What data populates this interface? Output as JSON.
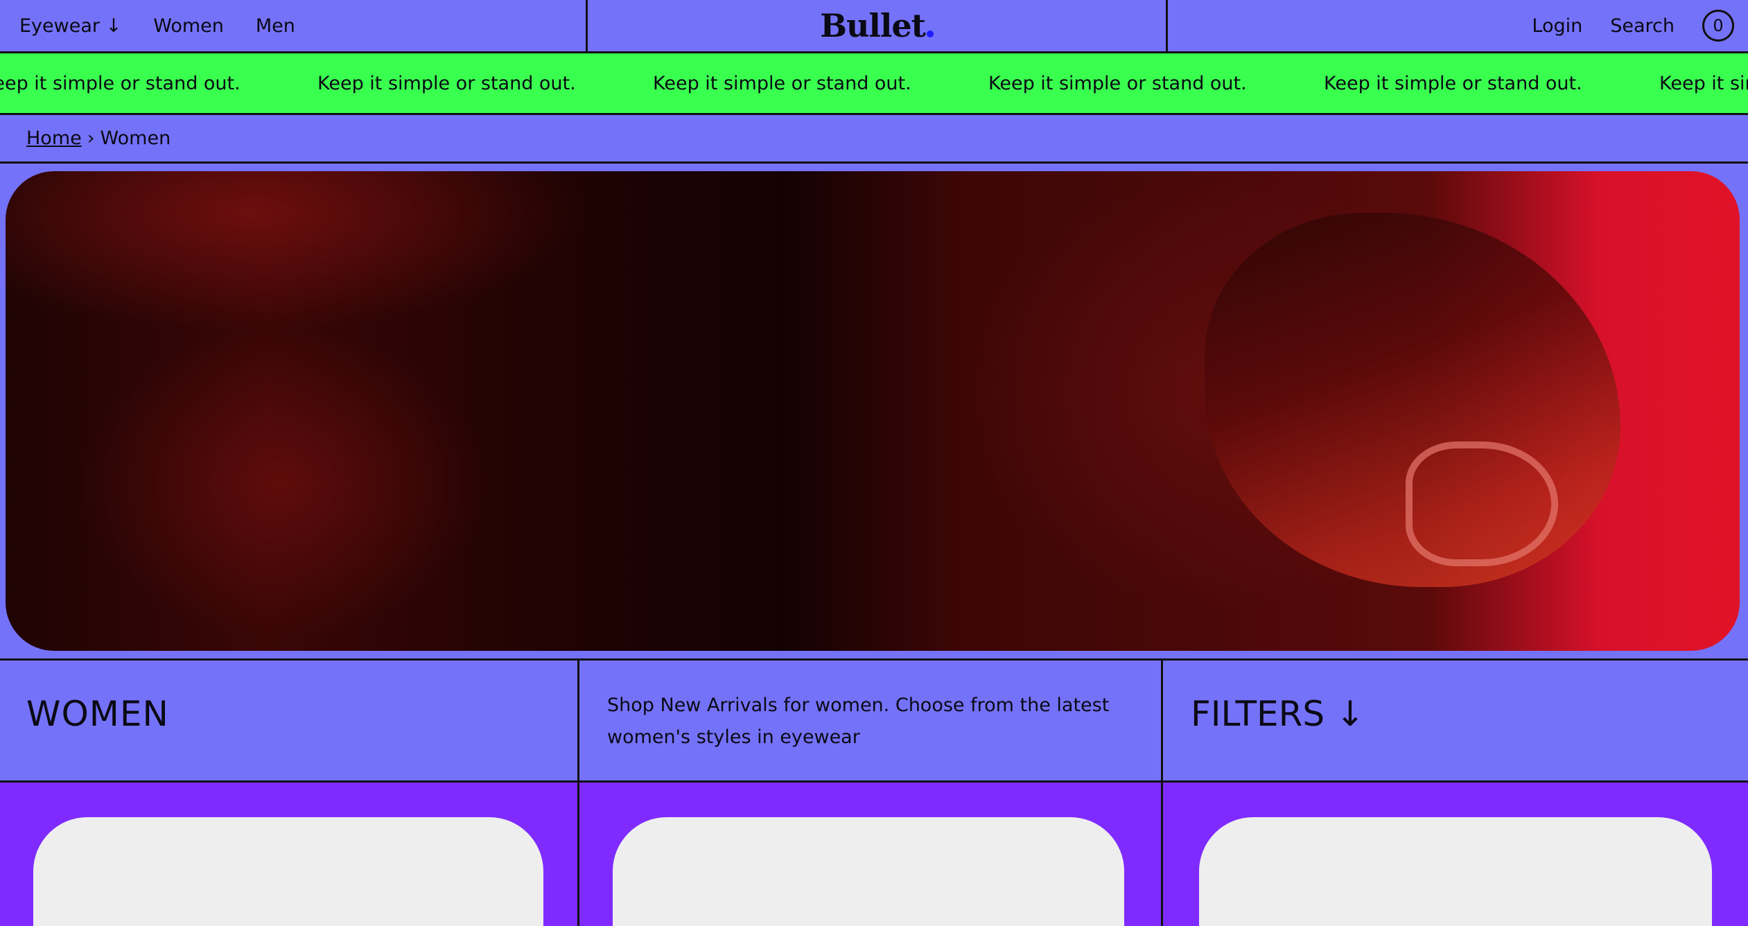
{
  "nav": {
    "left": [
      "Eyewear ↓",
      "Women",
      "Men"
    ],
    "logo": "Bullet",
    "login": "Login",
    "search": "Search",
    "cart_count": "0"
  },
  "marquee": {
    "text": "Keep it simple or stand out.",
    "repeats": 6
  },
  "breadcrumb": {
    "home": "Home",
    "separator": "›",
    "current": "Women"
  },
  "hero": {
    "image": "woman-red-sunglasses"
  },
  "collection": {
    "title": "WOMEN",
    "description": "Shop New Arrivals for women. Choose from the latest women's styles in eyewear",
    "filters_label": "FILTERS ↓"
  },
  "colors": {
    "background": "#7572fa",
    "marquee": "#39ff4f",
    "products_bg": "#7f2bff",
    "card": "#eeeeee",
    "logo_dot": "#1d1dff"
  },
  "products": [
    {
      "image": "product-placeholder"
    },
    {
      "image": "product-placeholder"
    },
    {
      "image": "product-placeholder"
    }
  ]
}
